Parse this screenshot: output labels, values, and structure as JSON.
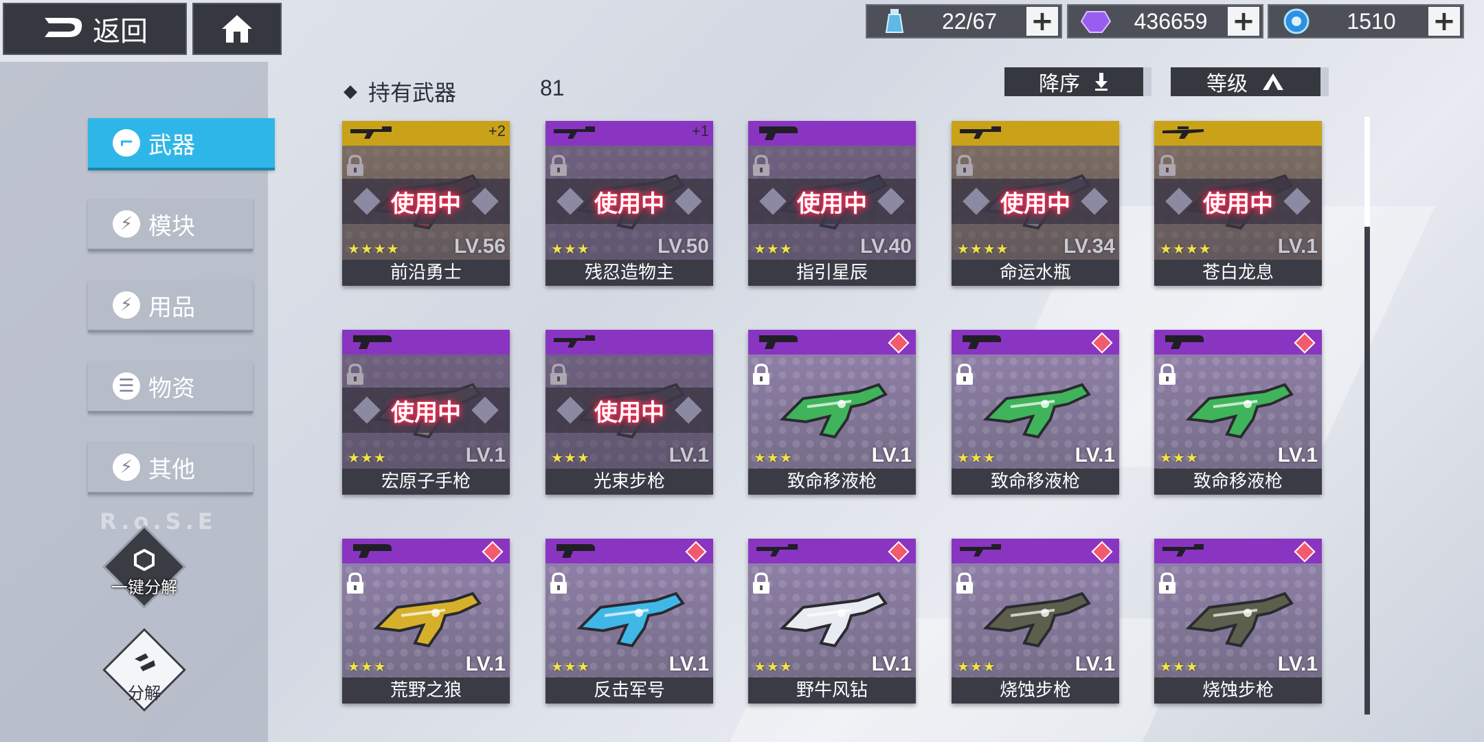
{
  "header": {
    "back_label": "返回",
    "resources": [
      {
        "name": "stamina",
        "icon": "potion-icon",
        "value": "22/67"
      },
      {
        "name": "crystal",
        "icon": "purple-crystal-icon",
        "value": "436659"
      },
      {
        "name": "orb",
        "icon": "blue-orb-icon",
        "value": "1510"
      }
    ],
    "plus_label": "+"
  },
  "sidebar": {
    "items": [
      {
        "label": "武器",
        "active": true
      },
      {
        "label": "模块",
        "active": false
      },
      {
        "label": "用品",
        "active": false
      },
      {
        "label": "物资",
        "active": false
      },
      {
        "label": "其他",
        "active": false
      }
    ],
    "watermark": "R.o.S.E",
    "quick_dismantle_label": "一键分解",
    "dismantle_label": "分解"
  },
  "main": {
    "owned_label": "持有武器",
    "owned_count": "81",
    "sort_order_label": "降序",
    "sort_by_label": "等级",
    "in_use_label": "使用中",
    "cards": [
      {
        "name": "前沿勇士",
        "level": "LV.56",
        "stars": "★★★★",
        "rarity": "gold",
        "in_use": true,
        "plus": "+2",
        "gun": "rifle",
        "color": "#b43f45"
      },
      {
        "name": "残忍造物主",
        "level": "LV.50",
        "stars": "★★★",
        "rarity": "purple",
        "in_use": true,
        "plus": "+1",
        "gun": "rifle",
        "color": "#6b6f7a"
      },
      {
        "name": "指引星辰",
        "level": "LV.40",
        "stars": "★★★",
        "rarity": "purple",
        "in_use": true,
        "plus": "",
        "gun": "pistol",
        "color": "#4a6fa8"
      },
      {
        "name": "命运水瓶",
        "level": "LV.34",
        "stars": "★★★★",
        "rarity": "gold",
        "in_use": true,
        "plus": "",
        "gun": "rifle",
        "color": "#9aa4b4"
      },
      {
        "name": "苍白龙息",
        "level": "LV.1",
        "stars": "★★★★",
        "rarity": "gold",
        "in_use": true,
        "plus": "",
        "gun": "sniper",
        "color": "#5a4f4a"
      },
      {
        "name": "宏原子手枪",
        "level": "LV.1",
        "stars": "★★★",
        "rarity": "purple",
        "in_use": true,
        "plus": "",
        "gun": "pistol",
        "color": "#b8a89a"
      },
      {
        "name": "光束步枪",
        "level": "LV.1",
        "stars": "★★★",
        "rarity": "purple",
        "in_use": true,
        "plus": "",
        "gun": "rifle",
        "color": "#8a7f88"
      },
      {
        "name": "致命移液枪",
        "level": "LV.1",
        "stars": "★★★",
        "rarity": "purple",
        "in_use": false,
        "plus": "",
        "gun": "pistol",
        "color": "#3fb45a"
      },
      {
        "name": "致命移液枪",
        "level": "LV.1",
        "stars": "★★★",
        "rarity": "purple",
        "in_use": false,
        "plus": "",
        "gun": "pistol",
        "color": "#3fb45a"
      },
      {
        "name": "致命移液枪",
        "level": "LV.1",
        "stars": "★★★",
        "rarity": "purple",
        "in_use": false,
        "plus": "",
        "gun": "pistol",
        "color": "#3fb45a"
      },
      {
        "name": "荒野之狼",
        "level": "LV.1",
        "stars": "★★★",
        "rarity": "purple",
        "in_use": false,
        "plus": "",
        "gun": "pistol",
        "color": "#d6b02a"
      },
      {
        "name": "反击军号",
        "level": "LV.1",
        "stars": "★★★",
        "rarity": "purple",
        "in_use": false,
        "plus": "",
        "gun": "pistol",
        "color": "#3fb8e8"
      },
      {
        "name": "野牛风钻",
        "level": "LV.1",
        "stars": "★★★",
        "rarity": "purple",
        "in_use": false,
        "plus": "",
        "gun": "rifle",
        "color": "#e8ecf2"
      },
      {
        "name": "烧蚀步枪",
        "level": "LV.1",
        "stars": "★★★",
        "rarity": "purple",
        "in_use": false,
        "plus": "",
        "gun": "rifle",
        "color": "#5b5f4c"
      },
      {
        "name": "烧蚀步枪",
        "level": "LV.1",
        "stars": "★★★",
        "rarity": "purple",
        "in_use": false,
        "plus": "",
        "gun": "rifle",
        "color": "#5b5f4c"
      }
    ]
  }
}
